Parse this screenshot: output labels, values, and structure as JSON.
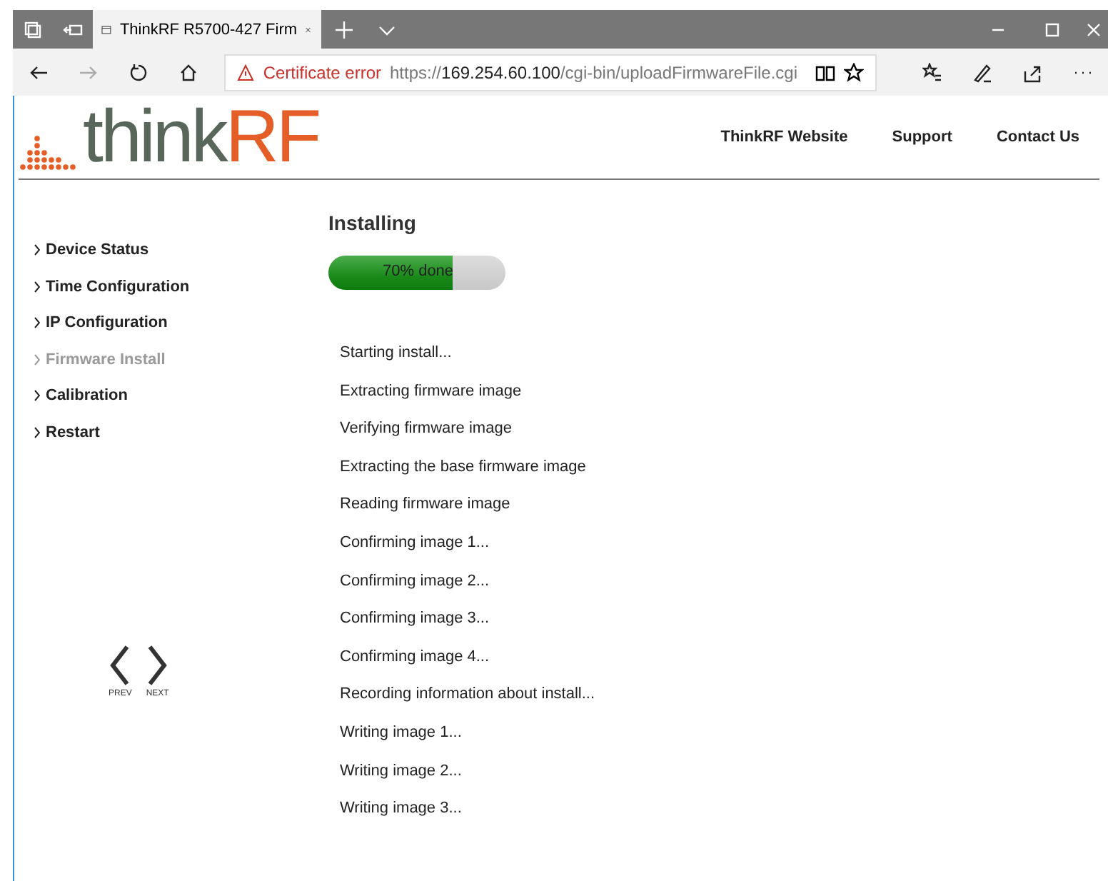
{
  "browser": {
    "tab_title": "ThinkRF R5700-427 Firm",
    "certificate_warning": "Certificate error",
    "url_prefix": "https://",
    "url_host": "169.254.60.100",
    "url_path": "/cgi-bin/uploadFirmwareFile.cgi"
  },
  "header": {
    "logo_dark": "think",
    "logo_accent": "RF",
    "links": [
      "ThinkRF Website",
      "Support",
      "Contact Us"
    ]
  },
  "sidebar": {
    "items": [
      {
        "label": "Device Status",
        "selected": false
      },
      {
        "label": "Time Configuration",
        "selected": false
      },
      {
        "label": "IP Configuration",
        "selected": false
      },
      {
        "label": "Firmware Install",
        "selected": true
      },
      {
        "label": "Calibration",
        "selected": false
      },
      {
        "label": "Restart",
        "selected": false
      }
    ],
    "prev_label": "PREV",
    "next_label": "NEXT"
  },
  "main": {
    "title": "Installing",
    "progress": {
      "level": 0.7,
      "label": "70% done"
    },
    "log": [
      "Starting install...",
      "Extracting firmware image",
      "Verifying firmware image",
      "Extracting the base firmware image",
      "Reading firmware image",
      "Confirming image 1...",
      "Confirming image 2...",
      "Confirming image 3...",
      "Confirming image 4...",
      "Recording information about install...",
      "Writing image 1...",
      "Writing image 2...",
      "Writing image 3..."
    ]
  }
}
